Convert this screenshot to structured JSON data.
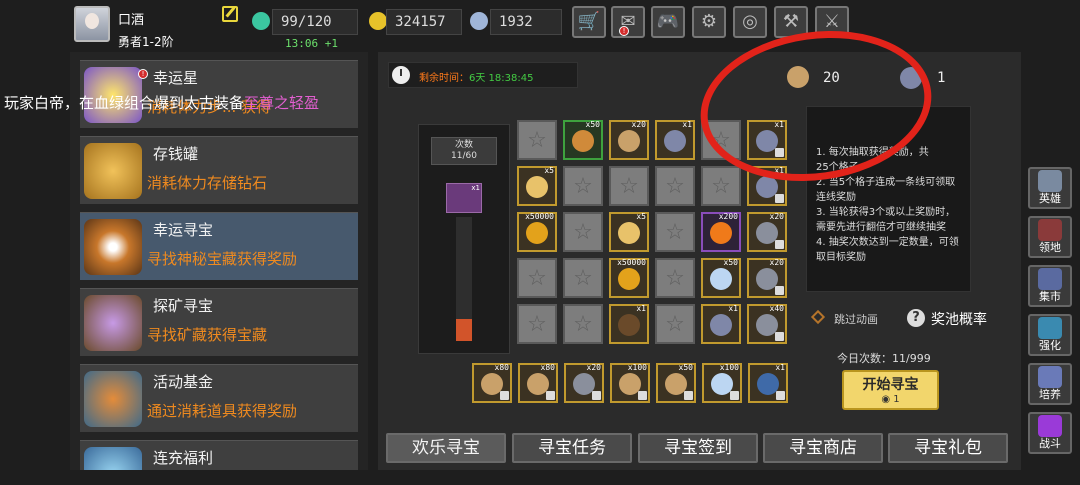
{
  "player": {
    "name": "口酒",
    "rank": "勇者1-2阶"
  },
  "stamina": {
    "value": "99/120",
    "timer": "13:06 +1"
  },
  "gold": "324157",
  "diamond": "1932",
  "top_buttons": [
    "shop-icon",
    "mail-icon",
    "gamepad-icon",
    "gear-icon",
    "rainbow-icon",
    "broom-icon",
    "swords-icon"
  ],
  "activities": [
    {
      "title": "幸运星",
      "desc": "消耗体力步... 获得"
    },
    {
      "title": "存钱罐",
      "desc": "消耗体力存储钻石"
    },
    {
      "title": "幸运寻宝",
      "desc": "寻找神秘宝藏获得奖励"
    },
    {
      "title": "探矿寻宝",
      "desc": "寻找矿藏获得宝藏"
    },
    {
      "title": "活动基金",
      "desc": "通过消耗道具获得奖励"
    },
    {
      "title": "连充福利",
      "desc": ""
    }
  ],
  "marquee": {
    "text": "玩家白帝，在血绿组合爆到太古装备",
    "highlight": "至尊之轻盈"
  },
  "remaining": {
    "label": "剩余时间：",
    "value": "6天  18:38:45"
  },
  "currency_a": "20",
  "currency_b": "1",
  "tries": {
    "label": "次数",
    "value": "11/60",
    "item_qty": "x1",
    "progress": 0.18
  },
  "grid": [
    [
      {
        "t": "empty"
      },
      {
        "t": "green",
        "q": "x50",
        "ic": "#d08a3a"
      },
      {
        "t": "gold",
        "q": "x20",
        "ic": "#c9a16a"
      },
      {
        "t": "gold",
        "q": "x1",
        "ic": "#7f87a8"
      },
      {
        "t": "empty"
      },
      {
        "t": "gold",
        "q": "x1",
        "ic": "#7f87a8",
        "lock": 1
      }
    ],
    [
      {
        "t": "gold",
        "q": "x5",
        "ic": "#e8c26a"
      },
      {
        "t": "empty"
      },
      {
        "t": "empty"
      },
      {
        "t": "empty"
      },
      {
        "t": "empty"
      },
      {
        "t": "gold",
        "q": "x1",
        "ic": "#7f87a8",
        "lock": 1
      }
    ],
    [
      {
        "t": "gold",
        "q": "x50000",
        "ic": "#e3a21b"
      },
      {
        "t": "empty"
      },
      {
        "t": "gold",
        "q": "x5",
        "ic": "#e8c26a"
      },
      {
        "t": "empty"
      },
      {
        "t": "purple",
        "q": "x200",
        "ic": "#f07a1a"
      },
      {
        "t": "gold",
        "q": "x20",
        "ic": "#8a8f9c",
        "lock": 1
      }
    ],
    [
      {
        "t": "empty"
      },
      {
        "t": "empty"
      },
      {
        "t": "gold",
        "q": "x50000",
        "ic": "#e3a21b"
      },
      {
        "t": "empty"
      },
      {
        "t": "gold",
        "q": "x50",
        "ic": "#bcd6f2"
      },
      {
        "t": "gold",
        "q": "x20",
        "ic": "#8a8f9c",
        "lock": 1
      }
    ],
    [
      {
        "t": "empty"
      },
      {
        "t": "empty"
      },
      {
        "t": "gold",
        "q": "x1",
        "ic": "#6a4a2a"
      },
      {
        "t": "empty"
      },
      {
        "t": "gold",
        "q": "x1",
        "ic": "#7f87a8"
      },
      {
        "t": "gold",
        "q": "x40",
        "ic": "#8a8f9c",
        "lock": 1
      }
    ]
  ],
  "bottom_row": [
    {
      "q": "x80",
      "ic": "#c9a16a"
    },
    {
      "q": "x80",
      "ic": "#c9a16a"
    },
    {
      "q": "x20",
      "ic": "#8a8f9c"
    },
    {
      "q": "x100",
      "ic": "#c9a16a"
    },
    {
      "q": "x50",
      "ic": "#c9a16a"
    },
    {
      "q": "x100",
      "ic": "#bcd6f2"
    },
    {
      "q": "x1",
      "ic": "#3f6aa8"
    }
  ],
  "info_lines": [
    "1. 每次抽取获得奖励，共",
    "25个格子",
    "2. 当5个格子连成一条线可领取连线奖励",
    "3. 当轮获得3个或以上奖励时，需要先进行翻倍才可继续抽奖",
    "4. 抽奖次数达到一定数量，可领取目标奖励"
  ],
  "skip_label": "跳过动画",
  "prob_label": "奖池概率",
  "today": "今日次数：11/999",
  "start": {
    "label": "开始寻宝",
    "cost": "1"
  },
  "tabs": [
    "欢乐寻宝",
    "寻宝任务",
    "寻宝签到",
    "寻宝商店",
    "寻宝礼包"
  ],
  "side_nav": [
    {
      "label": "英雄",
      "color": "#7a8aa0"
    },
    {
      "label": "领地",
      "color": "#8a3a3a"
    },
    {
      "label": "集市",
      "color": "#5a6aa0"
    },
    {
      "label": "强化",
      "color": "#3a8ab0"
    },
    {
      "label": "培养",
      "color": "#6a7ab8"
    },
    {
      "label": "战斗",
      "color": "#9a3ad8"
    }
  ]
}
